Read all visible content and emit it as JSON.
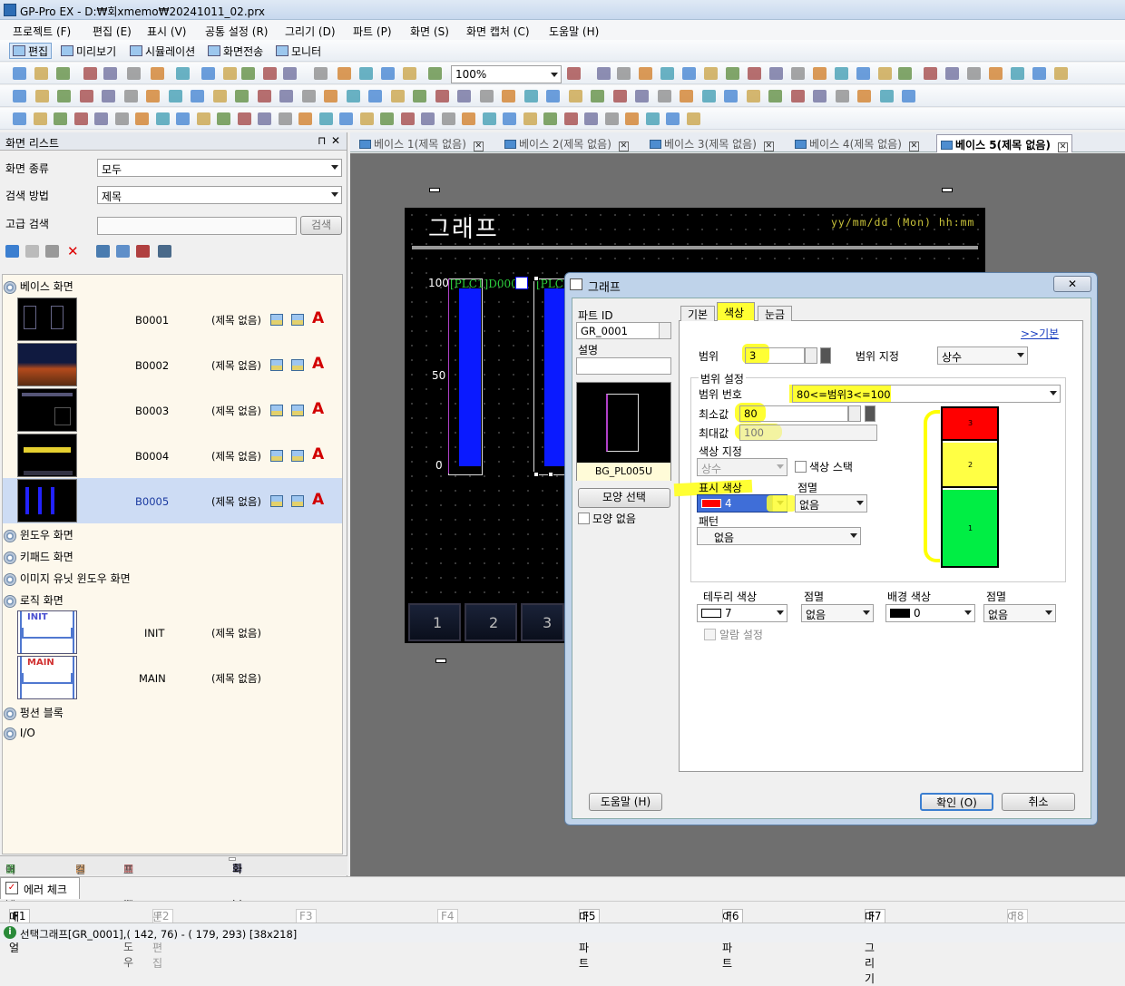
{
  "window": {
    "title": "GP-Pro EX - D:₩회xmemo₩20241011_02.prx"
  },
  "menu": [
    "프로젝트 (F)",
    "편집 (E)",
    "표시 (V)",
    "공통 설정 (R)",
    "그리기 (D)",
    "파트 (P)",
    "화면 (S)",
    "화면 캡처 (C)",
    "도움말 (H)"
  ],
  "toolbar": {
    "edit": "편집",
    "preview": "미리보기",
    "simulation": "시뮬레이션",
    "transfer": "화면전송",
    "monitor": "모니터",
    "zoom": "100%"
  },
  "screenlist": {
    "title": "화면 리스트",
    "pin": "⊓",
    "close": "✕",
    "type_label": "화면 종류",
    "type_value": "모두",
    "search_label": "검색 방법",
    "search_value": "제목",
    "adv_label": "고급 검색",
    "adv_button": "검색",
    "groups": {
      "base": "베이스 화면",
      "window": "윈도우 화면",
      "keypad": "키패드 화면",
      "image": "이미지 유닛 윈도우 화면",
      "logic": "로직 화면",
      "function": "펑션 블록",
      "io": "I/O"
    },
    "base_rows": [
      {
        "id": "B0001",
        "title": "(제목 없음)"
      },
      {
        "id": "B0002",
        "title": "(제목 없음)"
      },
      {
        "id": "B0003",
        "title": "(제목 없음)"
      },
      {
        "id": "B0004",
        "title": "(제목 없음)"
      },
      {
        "id": "B0005",
        "title": "(제목 없음)"
      }
    ],
    "logic_rows": [
      {
        "tag": "INIT",
        "id": "INIT",
        "title": "(제목 없음)"
      },
      {
        "tag": "MAIN",
        "id": "MAIN",
        "title": "(제목 없음)"
      }
    ],
    "bottom_tabs": [
      "어드레스",
      "컬러",
      "프로젝트 윈도우",
      "화면 리스트"
    ]
  },
  "doc_tabs": [
    "베이스 1(제목 없음)",
    "베이스 2(제목 없음)",
    "베이스 3(제목 없음)",
    "베이스 4(제목 없음)",
    "베이스 5(제목 없음)"
  ],
  "screen": {
    "title": "그래프",
    "date": "yy/mm/dd (Mon) hh:mm",
    "axis": [
      "100",
      "50",
      "0"
    ],
    "tag1": "[PLC1]D000",
    "tag2": "[PLC",
    "buttons": [
      "1",
      "2",
      "3"
    ]
  },
  "dialog": {
    "title": "그래프",
    "part_id_label": "파트 ID",
    "part_id": "GR_0001",
    "desc_label": "설명",
    "shape_name": "BG_PL005U",
    "shape_btn": "모양 선택",
    "no_shape": "모양 없음",
    "tabs": [
      "기본",
      "색상",
      "눈금"
    ],
    "basic_link": ">>기본",
    "range_label": "범위",
    "range_value": "3",
    "range_spec_label": "범위 지정",
    "range_spec_value": "상수",
    "range_settings": "범위 설정",
    "range_no_label": "범위 번호",
    "range_no_value": "80<=범위3<=100",
    "min_label": "최소값",
    "min_value": "80",
    "max_label": "최대값",
    "max_value": "100",
    "color_spec_label": "색상 지정",
    "color_spec_value": "상수",
    "color_stack": "색상 스택",
    "disp_color_label": "표시 색상",
    "disp_color_value": "4",
    "blink_label": "점멸",
    "blink_value": "없음",
    "pattern_label": "패턴",
    "pattern_value": "없음",
    "preview": [
      "3",
      "2",
      "1"
    ],
    "border_label": "테두리 색상",
    "border_value": "7",
    "blink2_label": "점멸",
    "blink2_value": "없음",
    "bg_label": "배경 색상",
    "bg_value": "0",
    "blink3_label": "점멸",
    "blink3_value": "없음",
    "alarm": "알람 설정",
    "help": "도움말 (H)",
    "ok": "확인 (O)",
    "cancel": "취소"
  },
  "error_tab": "에러 체크",
  "fkeys": [
    {
      "key": "F1",
      "label": "매뉴얼"
    },
    {
      "key": "F2",
      "label": "문자 편집"
    },
    {
      "key": "F3",
      "label": ""
    },
    {
      "key": "F4",
      "label": ""
    },
    {
      "key": "F5",
      "label": "다음 파트"
    },
    {
      "key": "F6",
      "label": "이전 파트"
    },
    {
      "key": "F7",
      "label": "다음 그리기"
    },
    {
      "key": "F8",
      "label": "이전"
    }
  ],
  "status": "선택그래프[GR_0001],( 142,  76) - ( 179, 293) [38x218]",
  "colors": {
    "red": "#ff0000",
    "yellow": "#ffff44",
    "green": "#00ee44",
    "highlight": "#ffff00",
    "bar_blue": "#0a1aff"
  }
}
